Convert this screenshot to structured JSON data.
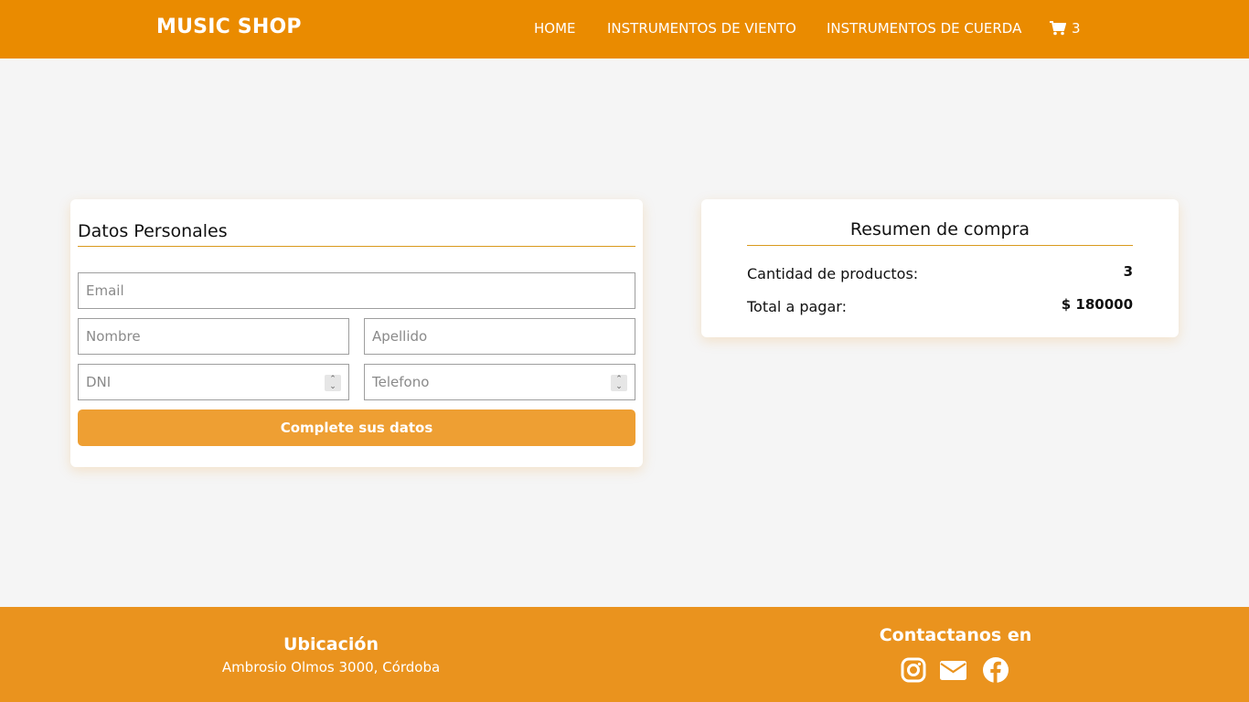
{
  "navbar": {
    "brand": "MUSIC SHOP",
    "links": [
      "HOME",
      "INSTRUMENTOS DE VIENTO",
      "INSTRUMENTOS DE CUERDA"
    ],
    "cart_count": "3",
    "cart_icon": "shopping-cart-icon",
    "background": "#ea8b00"
  },
  "form": {
    "title": "Datos Personales",
    "placeholders": {
      "email": "Email",
      "nombre": "Nombre",
      "apellido": "Apellido",
      "dni": "DNI",
      "telefono": "Telefono"
    },
    "submit_label": "Complete sus datos",
    "button_color": "#ee9f33"
  },
  "summary": {
    "title": "Resumen de compra",
    "rows": [
      {
        "label": "Cantidad de productos:",
        "value": "3"
      },
      {
        "label": "Total a pagar:",
        "value": "$ 180000"
      }
    ]
  },
  "footer": {
    "location_title": "Ubicación",
    "location_address": "Ambrosio Olmos 3000, Córdoba",
    "contact_title": "Contactanos en",
    "contact_icons": [
      "instagram-icon",
      "email-icon",
      "facebook-icon"
    ],
    "background": "#ea931e"
  }
}
